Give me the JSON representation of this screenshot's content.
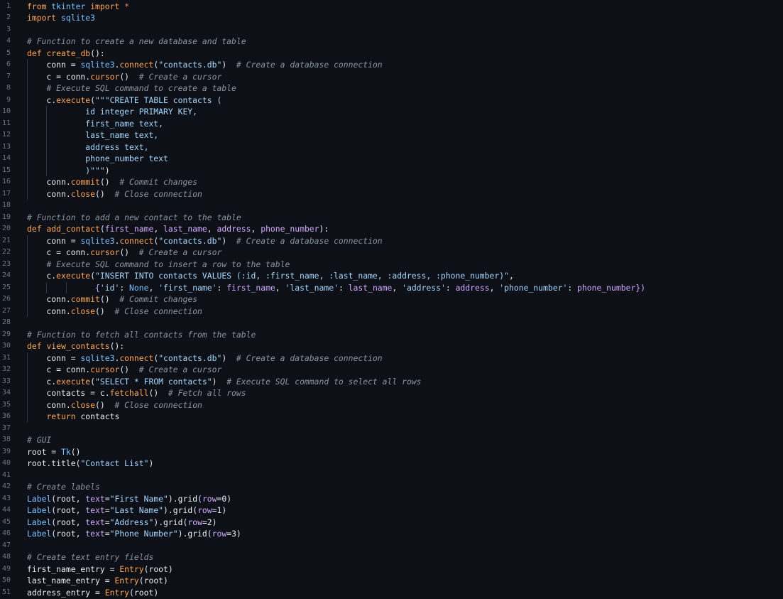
{
  "editor": {
    "theme_colors": {
      "background": "#0d1117",
      "line_number": "#6e7681",
      "text": "#e6edf3",
      "keyword": "#ffa657",
      "string": "#a5d6ff",
      "comment": "#8b949e",
      "param": "#d2a8ff",
      "builtin": "#79c0ff",
      "indent_guide": "#30363d"
    },
    "lines": [
      [
        {
          "t": "from ",
          "c": "k"
        },
        {
          "t": "tkinter ",
          "c": "m"
        },
        {
          "t": "import ",
          "c": "k"
        },
        {
          "t": "*",
          "c": "o"
        }
      ],
      [
        {
          "t": "import ",
          "c": "k"
        },
        {
          "t": "sqlite3",
          "c": "m"
        }
      ],
      [],
      [
        {
          "t": "# Function to create a new database and table",
          "c": "c"
        }
      ],
      [
        {
          "t": "def ",
          "c": "k"
        },
        {
          "t": "create_db",
          "c": "f"
        },
        {
          "t": "():",
          "c": "n"
        }
      ],
      [
        {
          "t": "    conn = ",
          "c": "n"
        },
        {
          "t": "sqlite3",
          "c": "m"
        },
        {
          "t": ".",
          "c": "n"
        },
        {
          "t": "connect",
          "c": "f"
        },
        {
          "t": "(",
          "c": "n"
        },
        {
          "t": "\"contacts.db\"",
          "c": "s"
        },
        {
          "t": ")  ",
          "c": "n"
        },
        {
          "t": "# Create a database connection",
          "c": "c"
        }
      ],
      [
        {
          "t": "    c = conn.",
          "c": "n"
        },
        {
          "t": "cursor",
          "c": "f"
        },
        {
          "t": "()  ",
          "c": "n"
        },
        {
          "t": "# Create a cursor",
          "c": "c"
        }
      ],
      [
        {
          "t": "    ",
          "c": "n"
        },
        {
          "t": "# Execute SQL command to create a table",
          "c": "c"
        }
      ],
      [
        {
          "t": "    c.",
          "c": "n"
        },
        {
          "t": "execute",
          "c": "f"
        },
        {
          "t": "(",
          "c": "n"
        },
        {
          "t": "\"\"\"CREATE TABLE contacts (",
          "c": "s"
        }
      ],
      [
        {
          "t": "            id integer PRIMARY KEY,",
          "c": "s"
        }
      ],
      [
        {
          "t": "            first_name text,",
          "c": "s"
        }
      ],
      [
        {
          "t": "            last_name text,",
          "c": "s"
        }
      ],
      [
        {
          "t": "            address text,",
          "c": "s"
        }
      ],
      [
        {
          "t": "            phone_number text",
          "c": "s"
        }
      ],
      [
        {
          "t": "            )\"\"\"",
          "c": "s"
        },
        {
          "t": ")",
          "c": "n"
        }
      ],
      [
        {
          "t": "    conn.",
          "c": "n"
        },
        {
          "t": "commit",
          "c": "f"
        },
        {
          "t": "()  ",
          "c": "n"
        },
        {
          "t": "# Commit changes",
          "c": "c"
        }
      ],
      [
        {
          "t": "    conn.",
          "c": "n"
        },
        {
          "t": "close",
          "c": "f"
        },
        {
          "t": "()  ",
          "c": "n"
        },
        {
          "t": "# Close connection",
          "c": "c"
        }
      ],
      [],
      [
        {
          "t": "# Function to add a new contact to the table",
          "c": "c"
        }
      ],
      [
        {
          "t": "def ",
          "c": "k"
        },
        {
          "t": "add_contact",
          "c": "f"
        },
        {
          "t": "(",
          "c": "n"
        },
        {
          "t": "first_name",
          "c": "p"
        },
        {
          "t": ", ",
          "c": "n"
        },
        {
          "t": "last_name",
          "c": "p"
        },
        {
          "t": ", ",
          "c": "n"
        },
        {
          "t": "address",
          "c": "p"
        },
        {
          "t": ", ",
          "c": "n"
        },
        {
          "t": "phone_number",
          "c": "p"
        },
        {
          "t": "):",
          "c": "n"
        }
      ],
      [
        {
          "t": "    conn = ",
          "c": "n"
        },
        {
          "t": "sqlite3",
          "c": "m"
        },
        {
          "t": ".",
          "c": "n"
        },
        {
          "t": "connect",
          "c": "f"
        },
        {
          "t": "(",
          "c": "n"
        },
        {
          "t": "\"contacts.db\"",
          "c": "s"
        },
        {
          "t": ")  ",
          "c": "n"
        },
        {
          "t": "# Create a database connection",
          "c": "c"
        }
      ],
      [
        {
          "t": "    c = conn.",
          "c": "n"
        },
        {
          "t": "cursor",
          "c": "f"
        },
        {
          "t": "()  ",
          "c": "n"
        },
        {
          "t": "# Create a cursor",
          "c": "c"
        }
      ],
      [
        {
          "t": "    ",
          "c": "n"
        },
        {
          "t": "# Execute SQL command to insert a row to the table",
          "c": "c"
        }
      ],
      [
        {
          "t": "    c.",
          "c": "n"
        },
        {
          "t": "execute",
          "c": "f"
        },
        {
          "t": "(",
          "c": "n"
        },
        {
          "t": "\"INSERT INTO contacts VALUES (:id, :first_name, :last_name, :address, :phone_number)\"",
          "c": "s"
        },
        {
          "t": ",",
          "c": "n"
        }
      ],
      [
        {
          "t": "              ",
          "c": "n"
        },
        {
          "t": "{",
          "c": "b"
        },
        {
          "t": "'id'",
          "c": "s"
        },
        {
          "t": ": ",
          "c": "n"
        },
        {
          "t": "None",
          "c": "t"
        },
        {
          "t": ", ",
          "c": "n"
        },
        {
          "t": "'first_name'",
          "c": "s"
        },
        {
          "t": ": ",
          "c": "n"
        },
        {
          "t": "first_name",
          "c": "p"
        },
        {
          "t": ", ",
          "c": "n"
        },
        {
          "t": "'last_name'",
          "c": "s"
        },
        {
          "t": ": ",
          "c": "n"
        },
        {
          "t": "last_name",
          "c": "p"
        },
        {
          "t": ", ",
          "c": "n"
        },
        {
          "t": "'address'",
          "c": "s"
        },
        {
          "t": ": ",
          "c": "n"
        },
        {
          "t": "address",
          "c": "p"
        },
        {
          "t": ", ",
          "c": "n"
        },
        {
          "t": "'phone_number'",
          "c": "s"
        },
        {
          "t": ": ",
          "c": "n"
        },
        {
          "t": "phone_number",
          "c": "p"
        },
        {
          "t": "})",
          "c": "b"
        }
      ],
      [
        {
          "t": "    conn.",
          "c": "n"
        },
        {
          "t": "commit",
          "c": "f"
        },
        {
          "t": "()  ",
          "c": "n"
        },
        {
          "t": "# Commit changes",
          "c": "c"
        }
      ],
      [
        {
          "t": "    conn.",
          "c": "n"
        },
        {
          "t": "close",
          "c": "f"
        },
        {
          "t": "()  ",
          "c": "n"
        },
        {
          "t": "# Close connection",
          "c": "c"
        }
      ],
      [],
      [
        {
          "t": "# Function to fetch all contacts from the table",
          "c": "c"
        }
      ],
      [
        {
          "t": "def ",
          "c": "k"
        },
        {
          "t": "view_contacts",
          "c": "f"
        },
        {
          "t": "():",
          "c": "n"
        }
      ],
      [
        {
          "t": "    conn = ",
          "c": "n"
        },
        {
          "t": "sqlite3",
          "c": "m"
        },
        {
          "t": ".",
          "c": "n"
        },
        {
          "t": "connect",
          "c": "f"
        },
        {
          "t": "(",
          "c": "n"
        },
        {
          "t": "\"contacts.db\"",
          "c": "s"
        },
        {
          "t": ")  ",
          "c": "n"
        },
        {
          "t": "# Create a database connection",
          "c": "c"
        }
      ],
      [
        {
          "t": "    c = conn.",
          "c": "n"
        },
        {
          "t": "cursor",
          "c": "f"
        },
        {
          "t": "()  ",
          "c": "n"
        },
        {
          "t": "# Create a cursor",
          "c": "c"
        }
      ],
      [
        {
          "t": "    c.",
          "c": "n"
        },
        {
          "t": "execute",
          "c": "f"
        },
        {
          "t": "(",
          "c": "n"
        },
        {
          "t": "\"SELECT * FROM contacts\"",
          "c": "s"
        },
        {
          "t": ")  ",
          "c": "n"
        },
        {
          "t": "# Execute SQL command to select all rows",
          "c": "c"
        }
      ],
      [
        {
          "t": "    contacts = c.",
          "c": "n"
        },
        {
          "t": "fetchall",
          "c": "f"
        },
        {
          "t": "()  ",
          "c": "n"
        },
        {
          "t": "# Fetch all rows",
          "c": "c"
        }
      ],
      [
        {
          "t": "    conn.",
          "c": "n"
        },
        {
          "t": "close",
          "c": "f"
        },
        {
          "t": "()  ",
          "c": "n"
        },
        {
          "t": "# Close connection",
          "c": "c"
        }
      ],
      [
        {
          "t": "    ",
          "c": "n"
        },
        {
          "t": "return ",
          "c": "k"
        },
        {
          "t": "contacts",
          "c": "n"
        }
      ],
      [],
      [
        {
          "t": "# GUI",
          "c": "c"
        }
      ],
      [
        {
          "t": "root = ",
          "c": "n"
        },
        {
          "t": "Tk",
          "c": "t"
        },
        {
          "t": "()",
          "c": "n"
        }
      ],
      [
        {
          "t": "root.title(",
          "c": "n"
        },
        {
          "t": "\"Contact List\"",
          "c": "s"
        },
        {
          "t": ")",
          "c": "n"
        }
      ],
      [],
      [
        {
          "t": "# Create labels",
          "c": "c"
        }
      ],
      [
        {
          "t": "Label",
          "c": "t"
        },
        {
          "t": "(root, ",
          "c": "n"
        },
        {
          "t": "text",
          "c": "p"
        },
        {
          "t": "=",
          "c": "n"
        },
        {
          "t": "\"First Name\"",
          "c": "s"
        },
        {
          "t": ").grid(",
          "c": "n"
        },
        {
          "t": "row",
          "c": "p"
        },
        {
          "t": "=0)",
          "c": "n"
        }
      ],
      [
        {
          "t": "Label",
          "c": "t"
        },
        {
          "t": "(root, ",
          "c": "n"
        },
        {
          "t": "text",
          "c": "p"
        },
        {
          "t": "=",
          "c": "n"
        },
        {
          "t": "\"Last Name\"",
          "c": "s"
        },
        {
          "t": ").grid(",
          "c": "n"
        },
        {
          "t": "row",
          "c": "p"
        },
        {
          "t": "=1)",
          "c": "n"
        }
      ],
      [
        {
          "t": "Label",
          "c": "t"
        },
        {
          "t": "(root, ",
          "c": "n"
        },
        {
          "t": "text",
          "c": "p"
        },
        {
          "t": "=",
          "c": "n"
        },
        {
          "t": "\"Address\"",
          "c": "s"
        },
        {
          "t": ").grid(",
          "c": "n"
        },
        {
          "t": "row",
          "c": "p"
        },
        {
          "t": "=2)",
          "c": "n"
        }
      ],
      [
        {
          "t": "Label",
          "c": "t"
        },
        {
          "t": "(root, ",
          "c": "n"
        },
        {
          "t": "text",
          "c": "p"
        },
        {
          "t": "=",
          "c": "n"
        },
        {
          "t": "\"Phone Number\"",
          "c": "s"
        },
        {
          "t": ").grid(",
          "c": "n"
        },
        {
          "t": "row",
          "c": "p"
        },
        {
          "t": "=3)",
          "c": "n"
        }
      ],
      [],
      [
        {
          "t": "# Create text entry fields",
          "c": "c"
        }
      ],
      [
        {
          "t": "first_name_entry = ",
          "c": "n"
        },
        {
          "t": "Entry",
          "c": "f"
        },
        {
          "t": "(root)",
          "c": "n"
        }
      ],
      [
        {
          "t": "last_name_entry = ",
          "c": "n"
        },
        {
          "t": "Entry",
          "c": "f"
        },
        {
          "t": "(root)",
          "c": "n"
        }
      ],
      [
        {
          "t": "address_entry = ",
          "c": "n"
        },
        {
          "t": "Entry",
          "c": "f"
        },
        {
          "t": "(root)",
          "c": "n"
        }
      ]
    ]
  }
}
